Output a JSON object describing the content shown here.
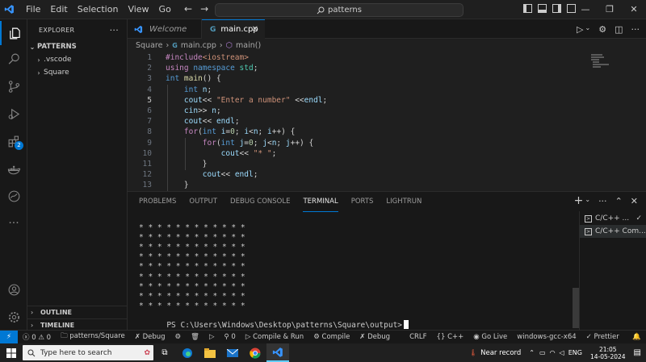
{
  "menu": [
    "File",
    "Edit",
    "Selection",
    "View",
    "Go"
  ],
  "command_center": {
    "text": "patterns"
  },
  "window_controls": [
    "—",
    "❐",
    "✕"
  ],
  "sidebar": {
    "title": "EXPLORER",
    "more": "···",
    "root": "PATTERNS",
    "items": [
      ".vscode",
      "Square"
    ],
    "outline": "OUTLINE",
    "timeline": "TIMELINE"
  },
  "activity_badge": "2",
  "tabs": {
    "welcome": "Welcome",
    "main": "main.cpp",
    "close": "✕"
  },
  "breadcrumb": {
    "folder": "Square",
    "file": "main.cpp",
    "symbol": "main()"
  },
  "code_lines": [
    {
      "n": "1",
      "html": [
        [
          "kw-pp",
          "#include"
        ],
        [
          "str",
          "<iostream>"
        ]
      ]
    },
    {
      "n": "2",
      "html": [
        [
          "kw-pp",
          "using "
        ],
        [
          "kw",
          "namespace "
        ],
        [
          "ty",
          "std"
        ],
        [
          "pl",
          ";"
        ]
      ]
    },
    {
      "n": "3",
      "html": [
        [
          "kw",
          "int "
        ],
        [
          "fn",
          "main"
        ],
        [
          "pl",
          "() {"
        ]
      ]
    },
    {
      "n": "4",
      "html": [
        [
          "pl",
          "    "
        ],
        [
          "kw",
          "int "
        ],
        [
          "id",
          "n"
        ],
        [
          "pl",
          ";"
        ]
      ]
    },
    {
      "n": "5",
      "html": [
        [
          "pl",
          "    "
        ],
        [
          "id",
          "cout"
        ],
        [
          "pl",
          "<< "
        ],
        [
          "str",
          "\"Enter a number\""
        ],
        [
          "pl",
          " <<"
        ],
        [
          "id",
          "endl"
        ],
        [
          "pl",
          ";"
        ]
      ]
    },
    {
      "n": "6",
      "html": [
        [
          "pl",
          "    "
        ],
        [
          "id",
          "cin"
        ],
        [
          "pl",
          ">> "
        ],
        [
          "id",
          "n"
        ],
        [
          "pl",
          ";"
        ]
      ]
    },
    {
      "n": "7",
      "html": [
        [
          "pl",
          "    "
        ],
        [
          "id",
          "cout"
        ],
        [
          "pl",
          "<< "
        ],
        [
          "id",
          "endl"
        ],
        [
          "pl",
          ";"
        ]
      ]
    },
    {
      "n": "8",
      "html": [
        [
          "pl",
          "    "
        ],
        [
          "ctrl",
          "for"
        ],
        [
          "pl",
          "("
        ],
        [
          "kw",
          "int "
        ],
        [
          "id",
          "i"
        ],
        [
          "pl",
          "="
        ],
        [
          "num",
          "0"
        ],
        [
          "pl",
          "; "
        ],
        [
          "id",
          "i"
        ],
        [
          "pl",
          "<"
        ],
        [
          "id",
          "n"
        ],
        [
          "pl",
          "; "
        ],
        [
          "id",
          "i"
        ],
        [
          "pl",
          "++) {"
        ]
      ]
    },
    {
      "n": "9",
      "html": [
        [
          "pl",
          "        "
        ],
        [
          "ctrl",
          "for"
        ],
        [
          "pl",
          "("
        ],
        [
          "kw",
          "int "
        ],
        [
          "id",
          "j"
        ],
        [
          "pl",
          "="
        ],
        [
          "num",
          "0"
        ],
        [
          "pl",
          "; "
        ],
        [
          "id",
          "j"
        ],
        [
          "pl",
          "<"
        ],
        [
          "id",
          "n"
        ],
        [
          "pl",
          "; "
        ],
        [
          "id",
          "j"
        ],
        [
          "pl",
          "++) {"
        ]
      ]
    },
    {
      "n": "10",
      "html": [
        [
          "pl",
          "            "
        ],
        [
          "id",
          "cout"
        ],
        [
          "pl",
          "<< "
        ],
        [
          "str",
          "\"* \""
        ],
        [
          "pl",
          ";"
        ]
      ]
    },
    {
      "n": "11",
      "html": [
        [
          "pl",
          "        }"
        ]
      ]
    },
    {
      "n": "12",
      "html": [
        [
          "pl",
          "        "
        ],
        [
          "id",
          "cout"
        ],
        [
          "pl",
          "<< "
        ],
        [
          "id",
          "endl"
        ],
        [
          "pl",
          ";"
        ]
      ]
    },
    {
      "n": "13",
      "html": [
        [
          "pl",
          "    }"
        ]
      ]
    }
  ],
  "panel": {
    "tabs": [
      "PROBLEMS",
      "OUTPUT",
      "DEBUG CONSOLE",
      "TERMINAL",
      "PORTS",
      "LIGHTRUN"
    ],
    "active_tab": "TERMINAL",
    "terminal_lines": [
      "* * * * * * * * * * * *",
      "* * * * * * * * * * * *",
      "* * * * * * * * * * * *",
      "* * * * * * * * * * * *",
      "* * * * * * * * * * * *",
      "* * * * * * * * * * * *",
      "* * * * * * * * * * * *",
      "* * * * * * * * * * * *",
      "* * * * * * * * * * * *"
    ],
    "prompt": "PS C:\\Users\\Windows\\Desktop\\patterns\\Square\\output>",
    "terminal_list": [
      "C/C++ ...",
      "C/C++ Com..."
    ]
  },
  "status": {
    "errors": "0",
    "warnings": "0",
    "folder": "patterns/Square",
    "debug": "Debug",
    "debug_count": "0",
    "compile_run": "Compile & Run",
    "compile": "Compile",
    "debug2": "Debug",
    "eol": "CRLF",
    "lang": "C++",
    "golive": "Go Live",
    "config": "windows-gcc-x64",
    "prettier": "Prettier"
  },
  "taskbar": {
    "search_placeholder": "Type here to search",
    "tray_text": "Near record",
    "lang": "ENG",
    "time": "21:05",
    "date": "14-05-2024"
  },
  "colors": {
    "accent": "#0078d4",
    "editor_bg": "#1f1f1f",
    "side_bg": "#181818"
  }
}
